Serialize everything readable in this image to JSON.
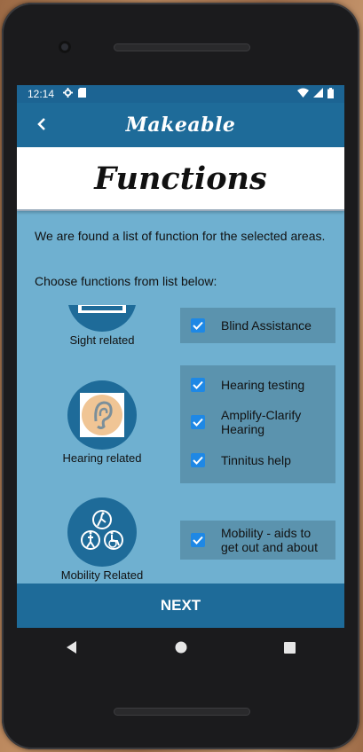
{
  "status_bar": {
    "time": "12:14"
  },
  "app_bar": {
    "title": "Makeable"
  },
  "header": {
    "title": "Functions"
  },
  "intro_text": "We are found a list of function for the selected areas.",
  "choose_text": "Choose functions from list below:",
  "categories": [
    {
      "label": "Sight related",
      "icon": "eye-chart-icon",
      "functions": [
        {
          "label": "Blind Assistance",
          "checked": true
        }
      ]
    },
    {
      "label": "Hearing related",
      "icon": "ear-icon",
      "functions": [
        {
          "label": "Hearing testing",
          "checked": true
        },
        {
          "label": "Amplify-Clarify Hearing",
          "checked": true
        },
        {
          "label": "Tinnitus help",
          "checked": true
        }
      ]
    },
    {
      "label": "Mobility Related",
      "icon": "mobility-icon",
      "functions": [
        {
          "label": "Mobility - aids to get out and about",
          "checked": true
        }
      ]
    }
  ],
  "footer": {
    "next_label": "NEXT"
  },
  "colors": {
    "primary": "#1e6b99",
    "background": "#6fb0d0",
    "panel": "#5b93ae",
    "checkbox": "#1e88e5"
  }
}
